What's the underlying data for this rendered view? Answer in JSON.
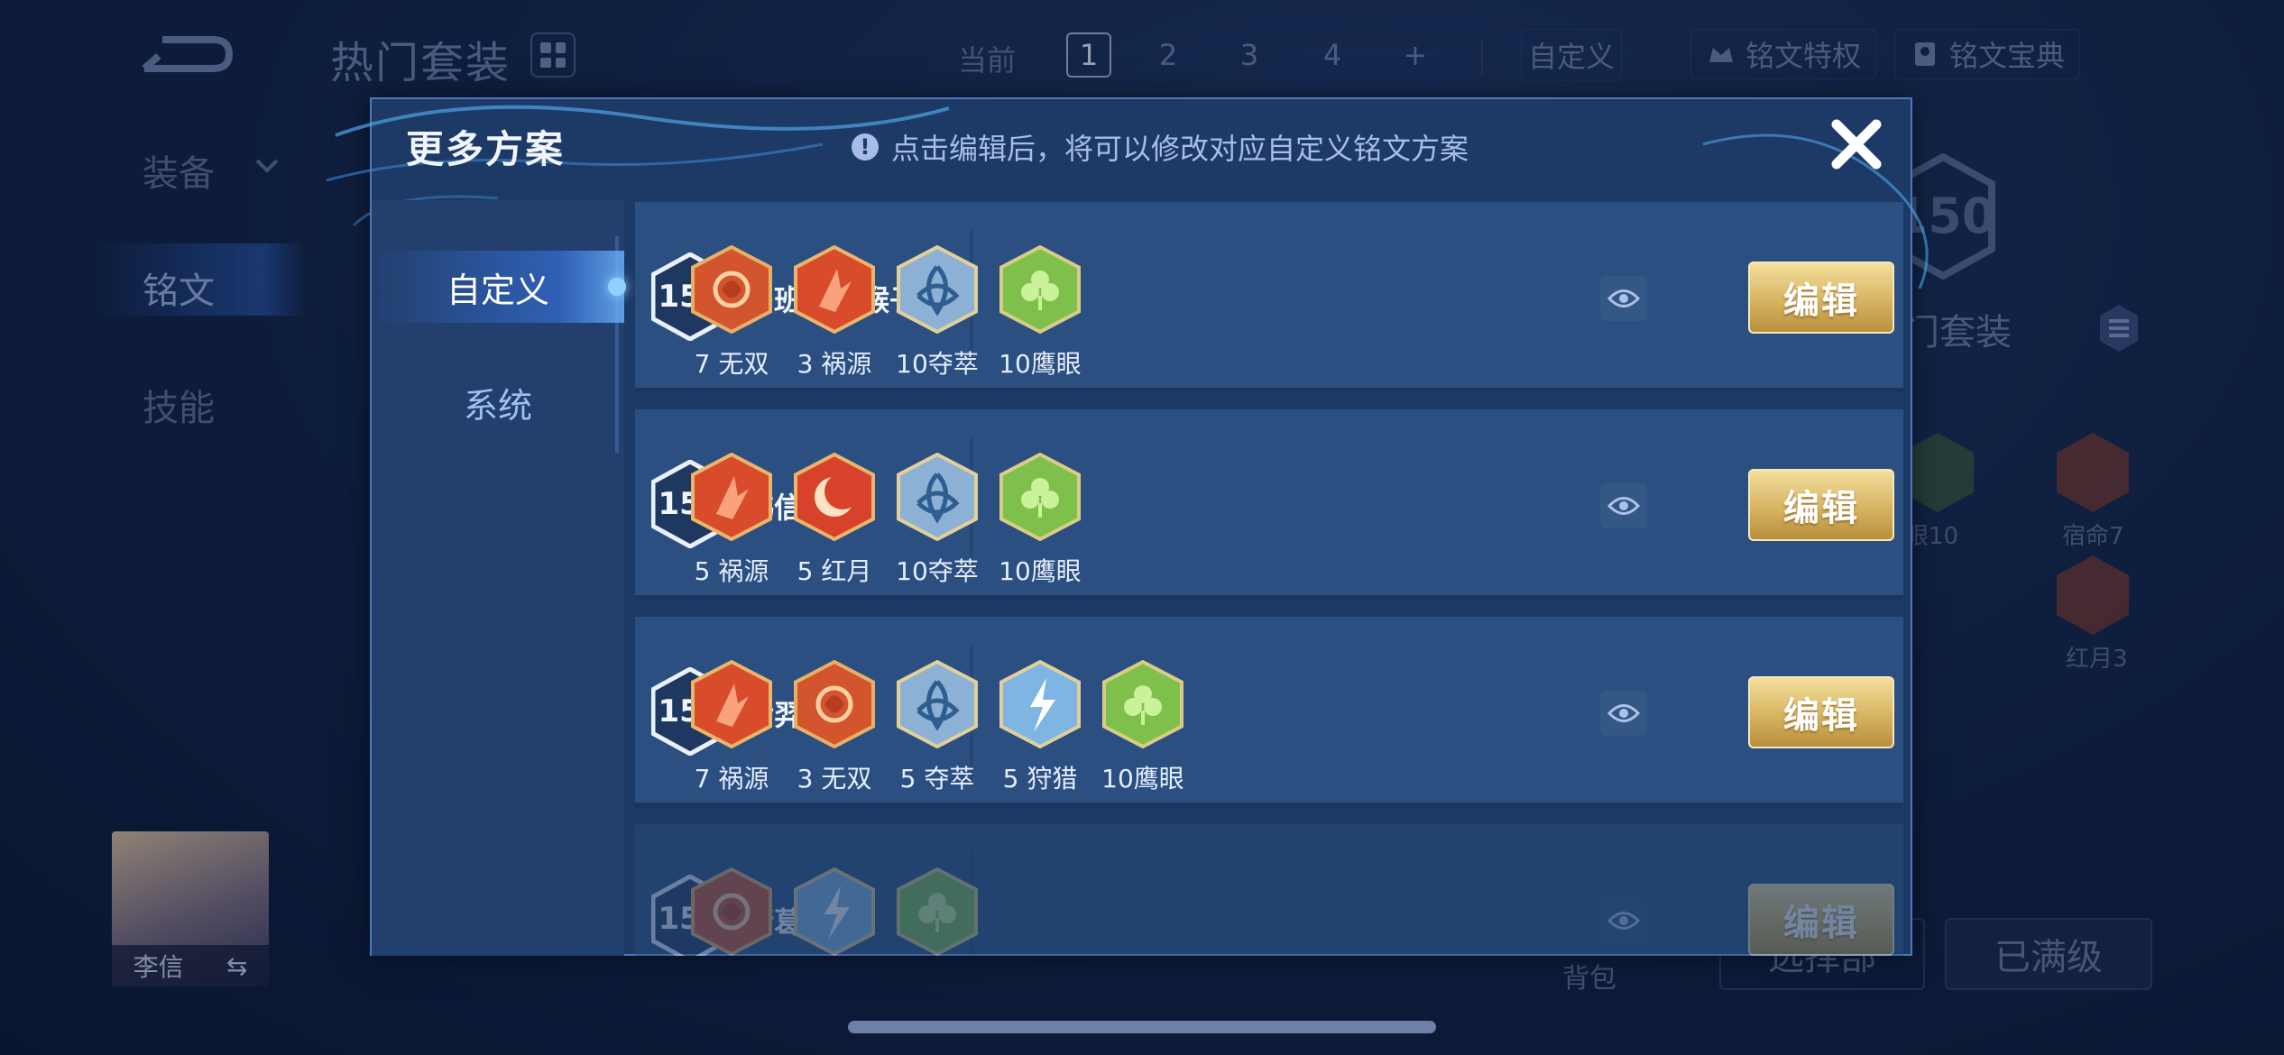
{
  "background": {
    "title": "热门套装",
    "current_label": "当前",
    "page_tabs": [
      "1",
      "2",
      "3",
      "4",
      "+"
    ],
    "active_page": "1",
    "custom_tab": "自定义",
    "rune_privilege": "铭文特权",
    "rune_guide": "铭文宝典",
    "nav": [
      "装备",
      "铭文",
      "技能"
    ],
    "hero_name": "李信",
    "hero_switch": "⇆",
    "right_level": "150",
    "right_title": "门套装",
    "right_runes": [
      {
        "label": "眼10"
      },
      {
        "label": "宿命7"
      },
      {
        "label": "红月3"
      }
    ],
    "bag_label": "背包",
    "select_btn": "选择部",
    "maxed_btn": "已满级"
  },
  "modal": {
    "title": "更多方案",
    "hint": "点击编辑后，将可以修改对应自定义铭文方案",
    "hint_icon": "!",
    "close_icon": "close-icon",
    "tabs": [
      "自定义",
      "系统"
    ],
    "edit_label": "编辑",
    "rows": [
      {
        "level": "150",
        "name": "鲁班——猴子",
        "runes": [
          {
            "label": "7 无双",
            "kind": "red-swirl"
          },
          {
            "label": "3 祸源",
            "kind": "red-shard"
          },
          {
            "label": "10夺萃",
            "kind": "blue-knot"
          },
          {
            "label": "10鹰眼",
            "kind": "green-clover"
          }
        ]
      },
      {
        "level": "150",
        "name": "韩信",
        "runes": [
          {
            "label": "5 祸源",
            "kind": "red-shard"
          },
          {
            "label": "5 红月",
            "kind": "red-moon"
          },
          {
            "label": "10夺萃",
            "kind": "blue-knot"
          },
          {
            "label": "10鹰眼",
            "kind": "green-clover"
          }
        ]
      },
      {
        "level": "150",
        "name": "后羿",
        "runes": [
          {
            "label": "7 祸源",
            "kind": "red-shard"
          },
          {
            "label": "3 无双",
            "kind": "red-swirl"
          },
          {
            "label": "5 夺萃",
            "kind": "blue-knot"
          },
          {
            "label": "5 狩猎",
            "kind": "blue-bolt"
          },
          {
            "label": "10鹰眼",
            "kind": "green-clover"
          }
        ]
      },
      {
        "level": "150",
        "name": "诸葛大力",
        "runes": [
          {
            "label": "",
            "kind": "red-swirl"
          },
          {
            "label": "",
            "kind": "blue-bolt"
          },
          {
            "label": "",
            "kind": "green-clover"
          }
        ]
      }
    ]
  },
  "colors": {
    "accent_gold": "#d7b461",
    "panel": "#1d3a66",
    "row": "#2b4f80",
    "red_rune": "#d2552e",
    "blue_rune": "#8fb3d6",
    "green_rune": "#7fbf4c"
  }
}
